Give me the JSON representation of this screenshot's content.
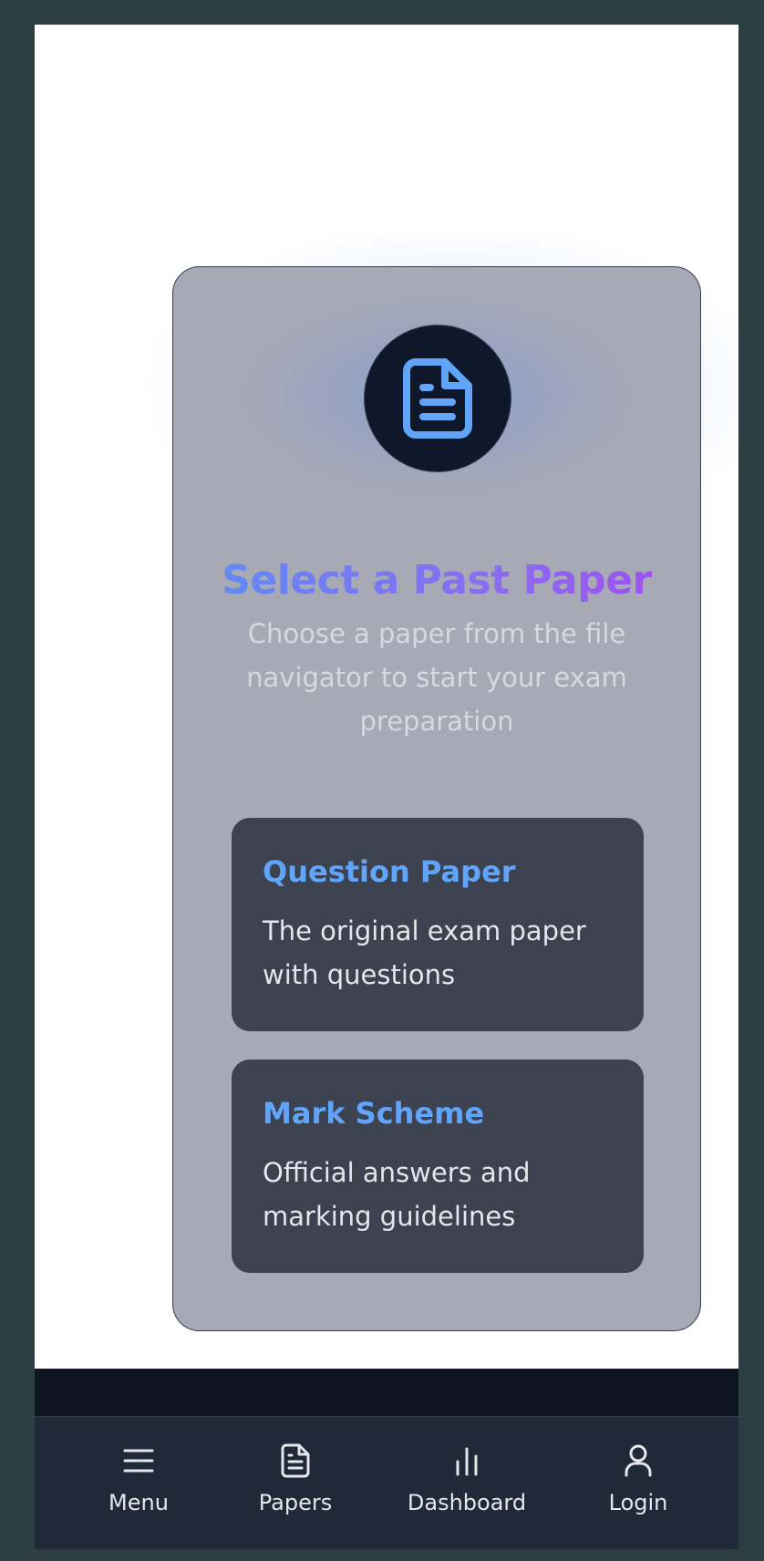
{
  "card": {
    "title": "Select a Past Paper",
    "subtitle": "Choose a paper from the file navigator to start your exam preparation",
    "icon": "document-icon",
    "options": [
      {
        "title": "Question Paper",
        "description": "The original exam paper with questions"
      },
      {
        "title": "Mark Scheme",
        "description": "Official answers and marking guidelines"
      }
    ]
  },
  "bottom_nav": {
    "items": [
      {
        "label": "Menu",
        "icon": "menu-icon"
      },
      {
        "label": "Papers",
        "icon": "document-icon"
      },
      {
        "label": "Dashboard",
        "icon": "bar-chart-icon"
      },
      {
        "label": "Login",
        "icon": "user-icon"
      }
    ]
  },
  "colors": {
    "accent": "#60a5fa",
    "gradient_start": "#5b8ef5",
    "gradient_end": "#a24bf0",
    "nav_bg": "#1f2937"
  }
}
